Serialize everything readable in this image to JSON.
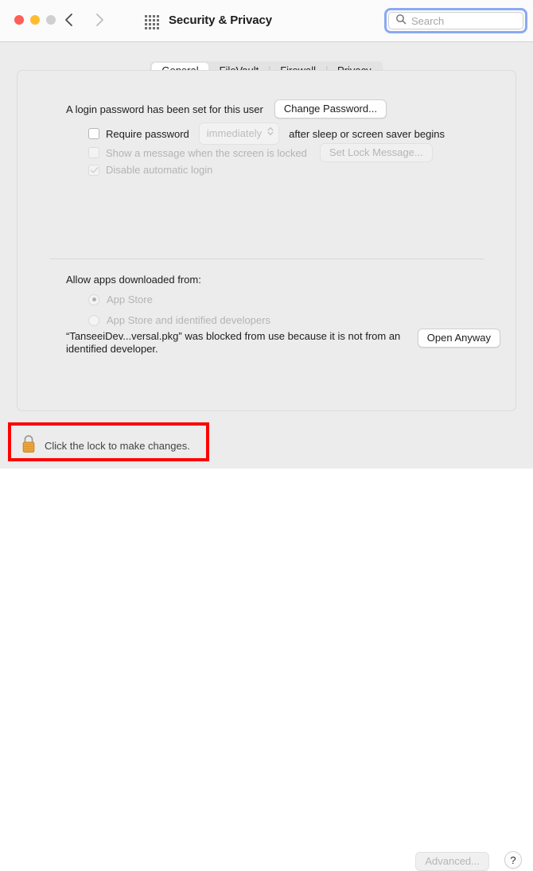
{
  "window": {
    "title": "Security & Privacy",
    "traffic_lights": [
      "close",
      "minimize",
      "maximize"
    ],
    "nav": {
      "back": "back-arrow",
      "forward": "forward-arrow"
    },
    "grid_icon": "show-all-preferences-icon"
  },
  "search": {
    "placeholder": "Search",
    "value": "",
    "icon": "search-icon",
    "focused": true
  },
  "tabs": [
    {
      "label": "General",
      "active": true
    },
    {
      "label": "FileVault",
      "active": false
    },
    {
      "label": "Firewall",
      "active": false
    },
    {
      "label": "Privacy",
      "active": false
    }
  ],
  "general": {
    "login_status": "A login password has been set for this user",
    "change_password_label": "Change Password...",
    "require_password": {
      "label": "Require password",
      "checked": false,
      "enabled": true,
      "select_value": "immediately",
      "suffix": "after sleep or screen saver begins"
    },
    "show_message": {
      "label": "Show a message when the screen is locked",
      "checked": false,
      "enabled": false,
      "button_label": "Set Lock Message..."
    },
    "disable_auto_login": {
      "label": "Disable automatic login",
      "checked": true,
      "enabled": false
    },
    "allow_apps_label": "Allow apps downloaded from:",
    "radios": [
      {
        "label": "App Store",
        "selected": true,
        "enabled": false
      },
      {
        "label": "App Store and identified developers",
        "selected": false,
        "enabled": false
      }
    ],
    "blocked_message": "“TanseeiDev...versal.pkg” was blocked from use because it is not from an identified developer.",
    "open_anyway_label": "Open Anyway"
  },
  "bottom": {
    "lock_icon": "closed-lock-icon",
    "lock_text": "Click the lock to make changes.",
    "advanced_label": "Advanced...",
    "help_label": "?",
    "advanced_enabled": false
  },
  "annotation": {
    "highlight_color": "#ff0000",
    "highlight_target": "lock-area"
  },
  "colors": {
    "window_bg": "#ececec",
    "titlebar_bg": "#fbfbfb",
    "accent_focus": "#8aa9f5",
    "lock_body": "#f0a93c",
    "text_primary": "#1d1d1f",
    "text_disabled": "#b4b4b4"
  }
}
